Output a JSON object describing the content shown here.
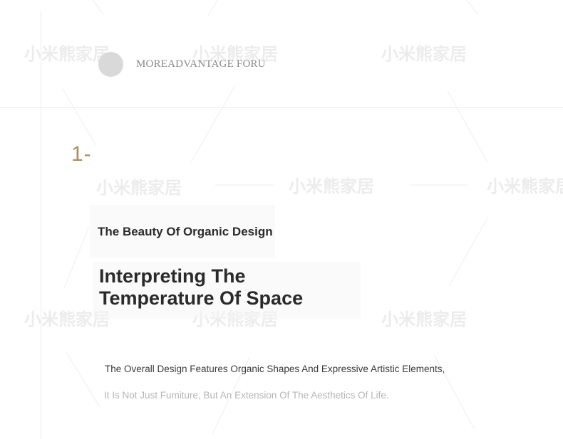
{
  "brand": {
    "text": "MOREADVANTAGE FORU"
  },
  "section": {
    "number": "1-",
    "subtitle": "The Beauty Of Organic Design",
    "title_line1": "Interpreting The",
    "title_line2": "Temperature Of Space",
    "description_line1": "The Overall Design Features Organic Shapes And Expressive Artistic Elements,",
    "description_line2": "It Is Not Just Fumiture, But An Extension Of The Aesthetics Of Life."
  },
  "watermark": {
    "text": "小米熊家居"
  },
  "colors": {
    "accent": "#b08d5a",
    "text_dark": "#2a2a2a",
    "text_muted": "#b5b5b5",
    "divider": "#ededed"
  }
}
